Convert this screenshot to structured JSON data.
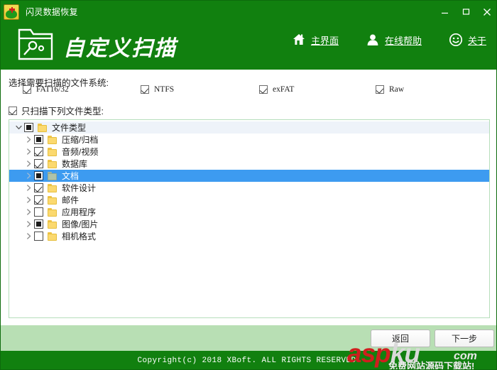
{
  "window": {
    "title": "闪灵数据恢复",
    "app_icon": "first-aid-disc-icon",
    "controls": {
      "minimize": "minimize-icon",
      "maximize": "maximize-icon",
      "close": "close-icon"
    }
  },
  "header": {
    "icon": "folder-gear-icon",
    "title": "自定义扫描",
    "nav": [
      {
        "icon": "home-icon",
        "label": "主界面"
      },
      {
        "icon": "person-icon",
        "label": "在线帮助"
      },
      {
        "icon": "smiley-icon",
        "label": "关于"
      }
    ]
  },
  "main": {
    "filesystem_label": "选择需要扫描的文件系统:",
    "filesystems": [
      {
        "label": "FAT16/32",
        "state": "checked"
      },
      {
        "label": "NTFS",
        "state": "checked"
      },
      {
        "label": "exFAT",
        "state": "checked"
      },
      {
        "label": "Raw",
        "state": "checked"
      }
    ],
    "only_types": {
      "label": "只扫描下列文件类型:",
      "state": "checked"
    },
    "tree": {
      "root": {
        "label": "文件类型",
        "state": "partial",
        "expanded": true,
        "twisty": "chevron-down-icon"
      },
      "items": [
        {
          "label": "压缩/归档",
          "state": "partial",
          "twisty": "chevron-right-icon",
          "selected": false
        },
        {
          "label": "音频/视频",
          "state": "checked",
          "twisty": "chevron-right-icon",
          "selected": false
        },
        {
          "label": "数据库",
          "state": "checked",
          "twisty": "chevron-right-icon",
          "selected": false
        },
        {
          "label": "文档",
          "state": "partial",
          "twisty": "chevron-right-icon",
          "selected": true
        },
        {
          "label": "软件设计",
          "state": "checked",
          "twisty": "chevron-right-icon",
          "selected": false
        },
        {
          "label": "邮件",
          "state": "checked",
          "twisty": "chevron-right-icon",
          "selected": false
        },
        {
          "label": "应用程序",
          "state": "unchecked",
          "twisty": "chevron-right-icon",
          "selected": false
        },
        {
          "label": "图像/图片",
          "state": "partial",
          "twisty": "chevron-right-icon",
          "selected": false
        },
        {
          "label": "相机格式",
          "state": "unchecked",
          "twisty": "chevron-right-icon",
          "selected": false
        }
      ]
    }
  },
  "buttons": {
    "back": "返回",
    "next": "下一步"
  },
  "footer": {
    "copyright": "Copyright(c) 2018 XBoft. ALL RIGHTS RESERVED."
  },
  "watermark": {
    "part_a": "asp",
    "part_b": "ku",
    "suffix": "com",
    "subtitle": "免费网站源码下载站!"
  },
  "colors": {
    "brand_green": "#11800f",
    "button_bar_green": "#b8dfb4",
    "selection_blue": "#3d9bf0",
    "folder_yellow": "#fbd96f",
    "watermark_red": "#cf1f1f"
  }
}
